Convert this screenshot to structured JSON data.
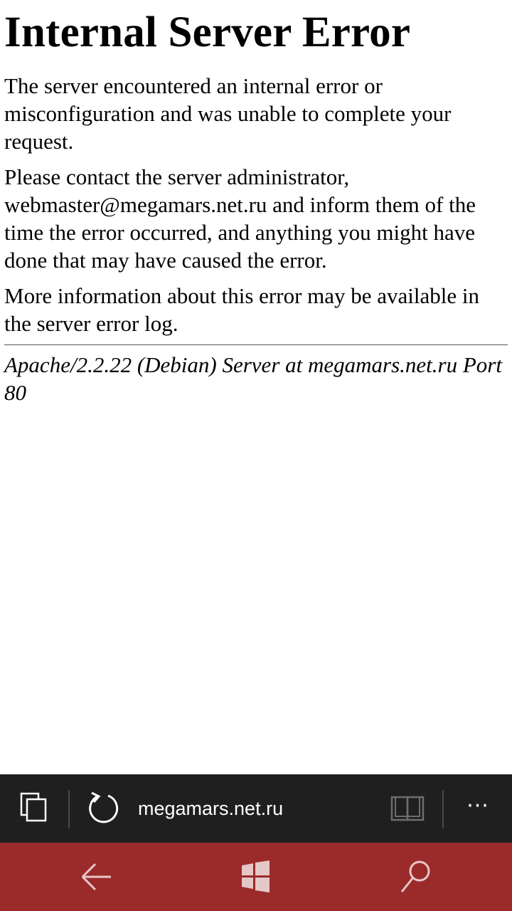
{
  "page": {
    "title": "Internal Server Error",
    "paragraphs": [
      "The server encountered an internal error or misconfiguration and was unable to complete your request.",
      "Please contact the server administrator, webmaster@megamars.net.ru and inform them of the time the error occurred, and anything you might have done that may have caused the error.",
      "More information about this error may be available in the server error log."
    ],
    "address": "Apache/2.2.22 (Debian) Server at megamars.net.ru Port 80"
  },
  "browser": {
    "url": "megamars.net.ru",
    "more_label": "···",
    "icons": [
      "tabs-icon",
      "refresh-icon",
      "reading-view-icon",
      "more-icon"
    ]
  },
  "nav": {
    "icons": [
      "back-arrow-icon",
      "windows-logo-icon",
      "search-icon"
    ]
  },
  "colors": {
    "address_bar": "#1f1f1f",
    "nav_bar": "#9b2a2a",
    "page_background": "#ffffff"
  }
}
